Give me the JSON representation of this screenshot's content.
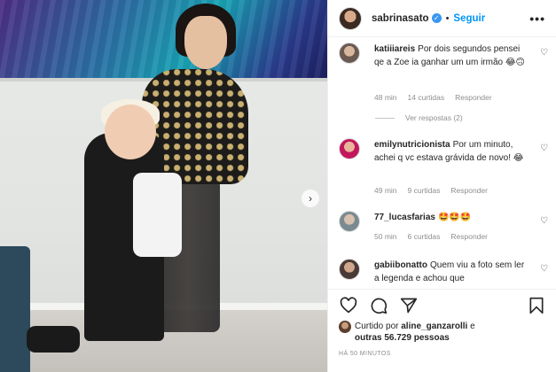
{
  "post": {
    "username": "sabrinasato",
    "verified_mark": "✓",
    "follow_label": "Seguir",
    "more_label": "•••",
    "next_arrow": "›"
  },
  "comments": [
    {
      "username": "katiiiareis",
      "text": "Por dois segundos pensei qe a Zoe ia ganhar um um irmão 😂🙃",
      "time": "48 min",
      "likes": "14 curtidas",
      "reply": "Responder",
      "view_replies": "Ver respostas (2)",
      "avatar_color": "#6b5a52"
    },
    {
      "username": "emilynutricionista",
      "text": "Por um minuto, achei q vc estava grávida de novo! 😂",
      "time": "49 min",
      "likes": "9 curtidas",
      "reply": "Responder",
      "avatar_color": "#c2185b"
    },
    {
      "username": "77_lucasfarias",
      "text": "🤩🤩🤩",
      "time": "50 min",
      "likes": "6 curtidas",
      "reply": "Responder",
      "avatar_color": "#7a8a90"
    },
    {
      "username": "gabiibonatto",
      "text": "Quem viu a foto sem ler a legenda e achou que",
      "avatar_color": "#4a3a36"
    }
  ],
  "likes": {
    "prefix": "Curtido por",
    "user": "aline_ganzarolli",
    "middle": "e",
    "others": "outras 56.729 pessoas"
  },
  "time_ago": "HÁ 50 MINUTOS",
  "icons": {
    "like": "heart-icon",
    "comment": "comment-icon",
    "share": "share-icon",
    "save": "bookmark-icon"
  },
  "colors": {
    "link_blue": "#0095f6",
    "verified_blue": "#3897f0",
    "muted_text": "#8e8e8e"
  }
}
